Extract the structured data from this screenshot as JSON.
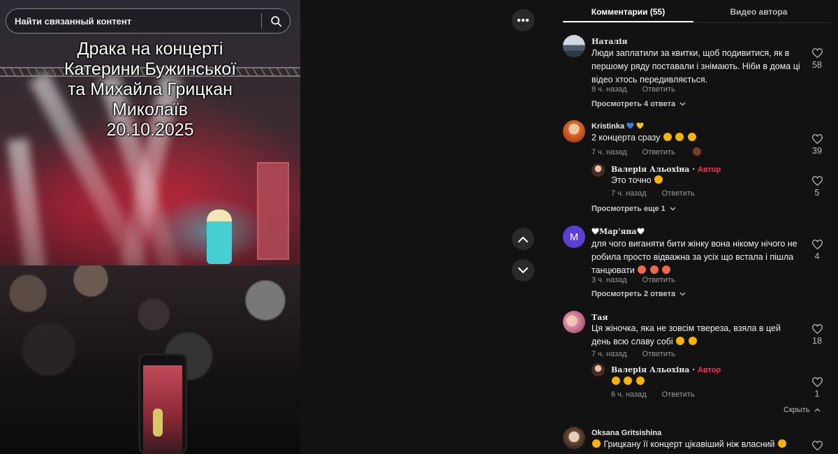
{
  "search": {
    "placeholder": "Найти связанный контент"
  },
  "video": {
    "title_lines": [
      "Драка на концерті",
      "Катерини Бужинської",
      "та Михайла Грицкан",
      "Миколаїв",
      "20.10.2025"
    ]
  },
  "tabs": [
    {
      "label": "Комментарии (55)",
      "active": true
    },
    {
      "label": "Видео автора",
      "active": false
    }
  ],
  "comments": [
    {
      "user": "Наталія",
      "text": "Люди заплатили за квитки, щоб подивитися, як в першому ряду поставали і знімають. Ніби в дома ці відео хтось передивляється.",
      "time": "8 ч. назад",
      "reply_label": "Ответить",
      "likes": "58",
      "more": "Просмотреть 4 ответа"
    },
    {
      "user": "Kristinka",
      "text": "2 концерта сразу",
      "time": "7 ч. назад",
      "reply_label": "Ответить",
      "likes": "39",
      "replies": [
        {
          "user": "Валерія Альохіна",
          "badge": "Автор",
          "text": "Это точно",
          "time": "7 ч. назад",
          "reply_label": "Ответить",
          "likes": "5"
        }
      ],
      "more": "Просмотреть еще 1"
    },
    {
      "user": "Мар'яна",
      "avatar_letter": "M",
      "text": "для чого виганяти бити жінку вона нікому нічого не робила просто відважна за усіх що встала і пішла танцювати",
      "time": "3 ч. назад",
      "reply_label": "Ответить",
      "likes": "4",
      "more": "Просмотреть 2 ответа"
    },
    {
      "user": "Тая",
      "text": "Ця жіночка, яка не зовсім твереза, взяла в цей день всю славу собі",
      "time": "7 ч. назад",
      "reply_label": "Ответить",
      "likes": "18",
      "replies": [
        {
          "user": "Валерія Альохіна",
          "badge": "Автор",
          "text": "",
          "time": "6 ч. назад",
          "reply_label": "Ответить",
          "likes": "1"
        }
      ],
      "hide": "Скрыть"
    },
    {
      "user": "Oksana Gritsishina",
      "text": "Грицкану її концерт цікавіший ніж власний"
    }
  ],
  "colors": {
    "accent": "#fe2c55",
    "panel_bg": "#121212",
    "avatar_purple": "#5b3fd8"
  }
}
